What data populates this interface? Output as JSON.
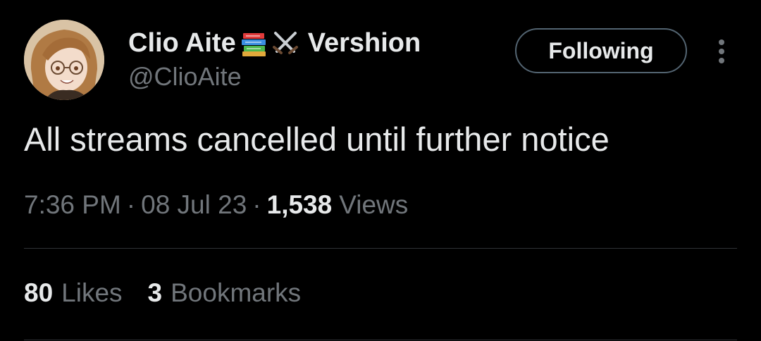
{
  "author": {
    "name": "Clio Aite",
    "name_suffix": "Vershion",
    "name_emojis": [
      "books-emoji-icon",
      "crossed-swords-emoji-icon"
    ],
    "handle": "@ClioAite"
  },
  "follow_button": {
    "label": "Following"
  },
  "more_button": {
    "icon": "more-vertical-icon"
  },
  "tweet": {
    "text": "All streams cancelled until further notice",
    "time": "7:36 PM",
    "separator": "·",
    "date": "08 Jul 23",
    "views_count": "1,538",
    "views_label": "Views"
  },
  "stats": {
    "likes_count": "80",
    "likes_label": "Likes",
    "bookmarks_count": "3",
    "bookmarks_label": "Bookmarks"
  },
  "colors": {
    "background": "#000000",
    "primary_text": "#e7e9ea",
    "secondary_text": "#71767b",
    "divider": "#2f3336",
    "button_border": "#536471"
  }
}
